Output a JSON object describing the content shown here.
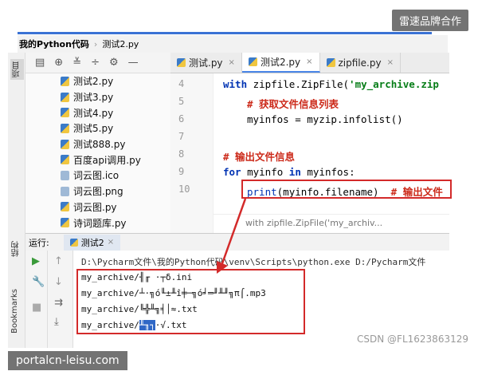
{
  "watermarks": {
    "top": "雷速品牌合作",
    "bottom": "portalcn-leisu.com",
    "csdn": "CSDN @FL1623863129"
  },
  "breadcrumb": {
    "project": "我的Python代码",
    "file": "测试2.py"
  },
  "left_strip": {
    "project": "项目",
    "structure": "结构",
    "bookmarks": "Bookmarks"
  },
  "project_toolbar": {
    "icons": [
      "layout-icon",
      "target-icon",
      "collapse-icon",
      "expand-icon",
      "gear-icon",
      "minimize-icon"
    ]
  },
  "files": [
    {
      "name": "测试2.py",
      "kind": "py"
    },
    {
      "name": "测试3.py",
      "kind": "py"
    },
    {
      "name": "测试4.py",
      "kind": "py"
    },
    {
      "name": "测试5.py",
      "kind": "py"
    },
    {
      "name": "测试888.py",
      "kind": "py"
    },
    {
      "name": "百度api调用.py",
      "kind": "py"
    },
    {
      "name": "词云图.ico",
      "kind": "img"
    },
    {
      "name": "词云图.png",
      "kind": "img"
    },
    {
      "name": "词云图.py",
      "kind": "py"
    },
    {
      "name": "诗词题库.py",
      "kind": "py"
    }
  ],
  "tabs": [
    {
      "label": "测试.py"
    },
    {
      "label": "测试2.py"
    },
    {
      "label": "zipfile.py"
    }
  ],
  "line_numbers": [
    "4",
    "5",
    "6",
    "7",
    "8",
    "9",
    "10"
  ],
  "code": {
    "l4_kw": "with",
    "l4_rest": " zipfile.ZipFile(",
    "l4_str": "'my_archive.zip",
    "l5": "# 获取文件信息列表",
    "l6": "myinfos = myzip.infolist()",
    "l8": "# 输出文件信息",
    "l9_for": "for",
    "l9_mid": " myinfo ",
    "l9_in": "in",
    "l9_end": " myinfos:",
    "l10_fn": "print",
    "l10_rest": "(myinfo.filename)  ",
    "l10_cm": "# 输出文件"
  },
  "code_hint": "with zipfile.ZipFile('my_archiv...",
  "run": {
    "label": "运行:",
    "tab": "测试2"
  },
  "console": {
    "cmd": "D:\\Pycharm文件\\我的Python代码\\venv\\Scripts\\python.exe D:/Pycharm文件",
    "out1": "my_archive/╢╓ ·┬δ.ini",
    "out2": "my_archive/┴·╗ó╙±╨î╪─╗ó╛═╜╨╜╗π⌠.mp3",
    "out3": "my_archive/╚╬╨╗╡│≈.txt",
    "out4_pre": "my_archive/",
    "out4_hl": "╨╖┐",
    "out4_post": "·√.txt"
  },
  "colors": {
    "accent": "#3a72d4",
    "highlight_box": "#d32a2a",
    "keyword": "#0033b3",
    "string": "#067d17",
    "comment": "#cc2a1a"
  }
}
